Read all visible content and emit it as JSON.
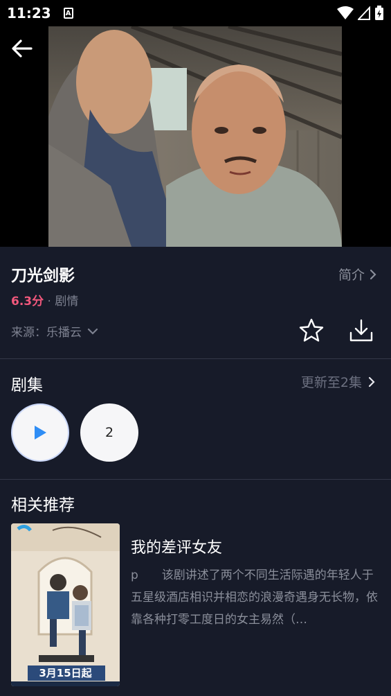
{
  "status_bar": {
    "time": "11:23",
    "notification_icon": "A"
  },
  "header": {
    "back_icon": "arrow-left-icon"
  },
  "video": {
    "description_only_visual": true
  },
  "show": {
    "title": "刀光剑影",
    "intro_label": "简介",
    "rating": "6.3分",
    "genre": "· 剧情",
    "source_label": "来源：乐播云"
  },
  "episodes": {
    "section_title": "剧集",
    "update_label": "更新至2集",
    "items": [
      "2"
    ]
  },
  "recommend": {
    "section_title": "相关推荐",
    "items": [
      {
        "title": "我的差评女友",
        "description": "p　　该剧讲述了两个不同生活际遇的年轻人于五星级酒店相识并相恋的浪漫奇遇身无长物，依靠各种打零工度日的女主易然（…",
        "poster_date": "3月15日起"
      }
    ]
  },
  "colors": {
    "background": "#171b29",
    "rating": "#f2587c",
    "play_accent": "#2f8df5"
  }
}
